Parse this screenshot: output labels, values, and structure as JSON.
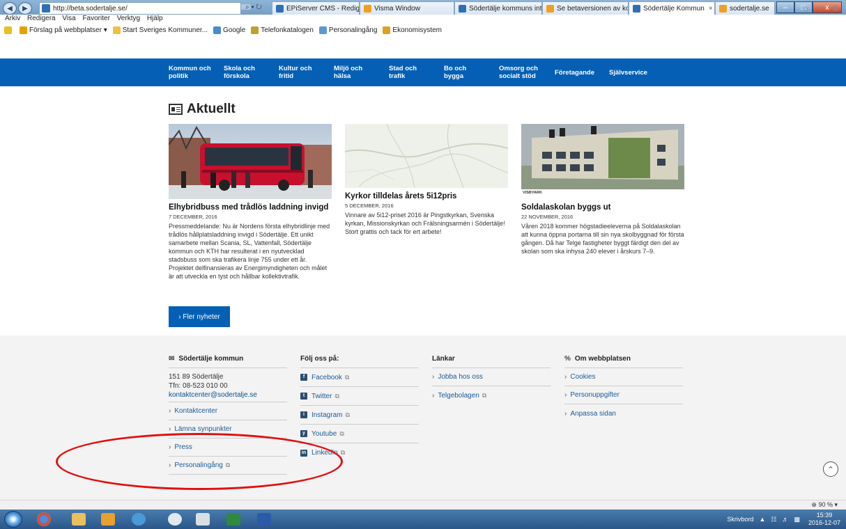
{
  "browser": {
    "url": "http://beta.sodertalje.se/",
    "address_tools": "⌕ ▾ ↻",
    "tabs": [
      {
        "label": "EPiServer CMS - Redigera",
        "color": "#2f6fb5"
      },
      {
        "label": "Visma Window",
        "color": "#f0a020"
      },
      {
        "label": "Södertälje kommuns intr...",
        "color": "#2f6fb5"
      },
      {
        "label": "Se betaversionen av kom...",
        "color": "#f0a020"
      },
      {
        "label": "Södertälje Kommun",
        "color": "#2f6fb5"
      },
      {
        "label": "sodertalje.se",
        "color": "#f0a020"
      }
    ],
    "tab_close": "×",
    "window_buttons": {
      "minimize": "–",
      "maximize": "□",
      "close": "x"
    },
    "toolbar_icons": "⌂ ☆ ⚙",
    "menu": [
      "Arkiv",
      "Redigera",
      "Visa",
      "Favoriter",
      "Verktyg",
      "Hjälp"
    ],
    "favorites": [
      {
        "label": "Förslag på webbplatser ▾",
        "color": "#e8a000"
      },
      {
        "label": "Start Sveriges Kommuner...",
        "color": "#f0c040"
      },
      {
        "label": "Google",
        "color": "#4a8ad0"
      },
      {
        "label": "Telefonkatalogen",
        "color": "#c0a030"
      },
      {
        "label": "Personalingång",
        "color": "#5a9ad0"
      },
      {
        "label": "Ekonomisystem",
        "color": "#e0a020"
      }
    ]
  },
  "site_nav": [
    {
      "line1": "Kommun och",
      "line2": "politik"
    },
    {
      "line1": "Skola och",
      "line2": "förskola"
    },
    {
      "line1": "Kultur och",
      "line2": "fritid"
    },
    {
      "line1": "Miljö och",
      "line2": "hälsa"
    },
    {
      "line1": "Stad och",
      "line2": "trafik"
    },
    {
      "line1": "Bo och",
      "line2": "bygga"
    },
    {
      "line1": "Omsorg och",
      "line2": "socialt stöd"
    },
    {
      "line1": "Företagande",
      "line2": ""
    },
    {
      "line1": "Självservice",
      "line2": ""
    }
  ],
  "news": {
    "heading": "Aktuellt",
    "items": [
      {
        "title": "Elhybridbuss med trådlös laddning invigd",
        "date": "7 DECEMBER, 2016",
        "body": "Pressmeddelande: Nu är Nordens första elhybridlinje med trådlös hållplatsladdning invigd i Södertälje. Ett unikt samarbete mellan Scania, SL, Vattenfall, Södertälje kommun och KTH har resulterat i en nyutvecklad stadsbuss som ska trafikera linje 755 under ett år. Projektet delfinansieras av Energimyndigheten och målet är att utveckla en tyst och hållbar kollektivtrafik."
      },
      {
        "title": "Kyrkor tilldelas årets 5i12pris",
        "date": "5 DECEMBER, 2016",
        "body": "Vinnare av 5i12-priset 2016 är Pingstkyrkan, Svenska kyrkan, Missionskyrkan och Frälsningsarmén i Södertälje! Stort grattis och tack för ert arbete!"
      },
      {
        "title": "Soldalaskolan byggs ut",
        "date": "22 NOVEMBER, 2016",
        "body": "Våren 2018 kommer högstadieeleverna på Soldalaskolan att kunna öppna portarna till sin nya skolbyggnad för första gången. Då har Telge fastigheter byggt färdigt den del av skolan som ska inhysa 240 elever i årskurs 7–9.",
        "image_caption": "VISBYARK"
      }
    ],
    "more_button": "›  Fler nyheter"
  },
  "footer": {
    "col1": {
      "heading": "Södertälje kommun",
      "address_line1": "151 89 Södertälje",
      "address_line2": "Tfn: 08-523 010 00",
      "email": "kontaktcenter@sodertalje.se",
      "links": [
        "Kontaktcenter",
        "Lämna synpunkter",
        "Press",
        "Personalingång"
      ]
    },
    "col2": {
      "heading": "Följ oss på:",
      "links": [
        "Facebook",
        "Twitter",
        "Instagram",
        "Youtube",
        "LinkedIn"
      ]
    },
    "col3": {
      "heading": "Länkar",
      "links": [
        "Jobba hos oss",
        "Telgebolagen"
      ]
    },
    "col4": {
      "heading": "Om webbplatsen",
      "links": [
        "Cookies",
        "Personuppgifter",
        "Anpassa sidan"
      ]
    }
  },
  "statusbar": {
    "zoom": "⊕ 90 %  ▾"
  },
  "taskbar": {
    "desktop_label": "Skrivbord",
    "time": "15:39",
    "date": "2016-12-07"
  },
  "colors": {
    "brand_blue": "#0560b5",
    "annotation_red": "#e01010"
  }
}
